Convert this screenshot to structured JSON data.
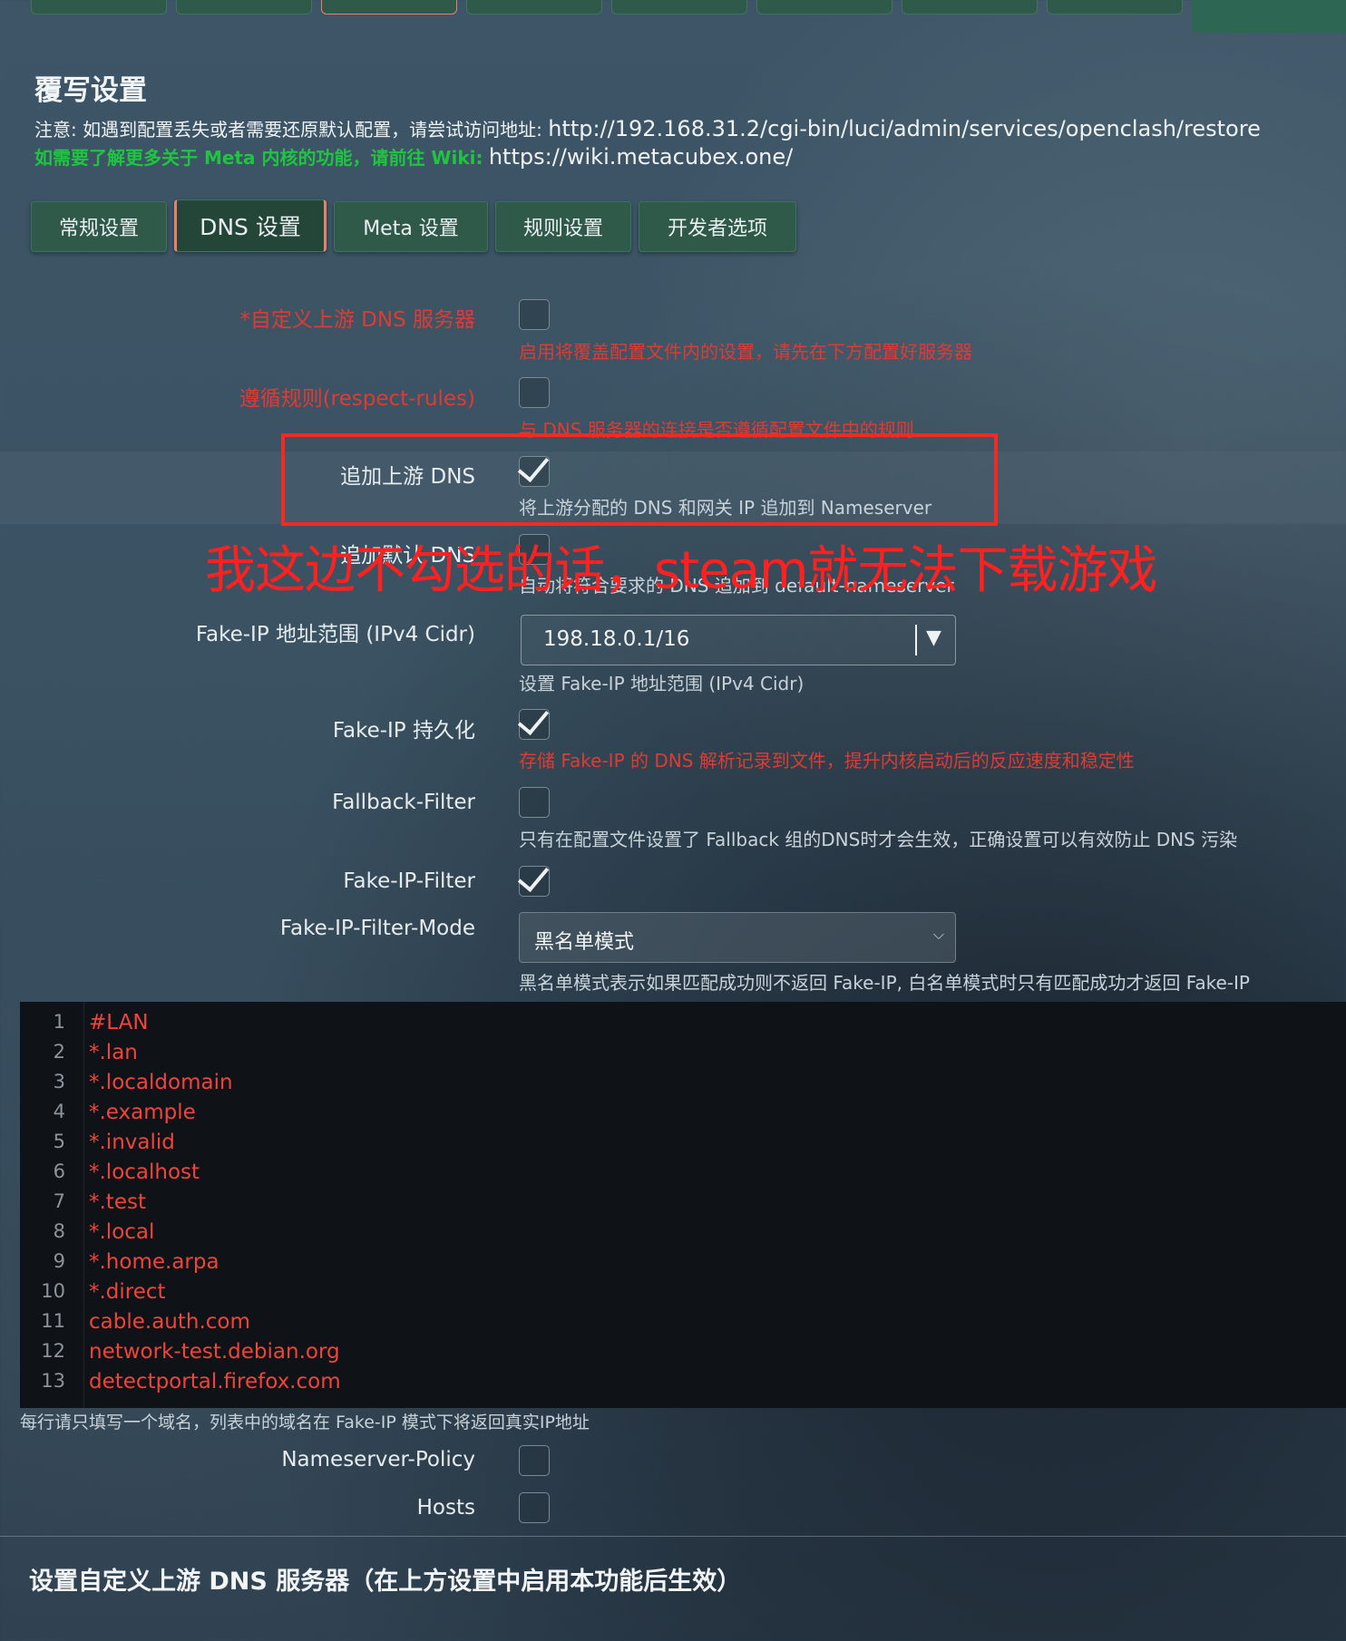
{
  "header": {
    "title": "覆写设置",
    "note_prefix": "注意: 如遇到配置丢失或者需要还原默认配置，请尝试访问地址:",
    "note_url": "http://192.168.31.2/cgi-bin/luci/admin/services/openclash/restore",
    "wiki_prefix": "如需要了解更多关于 Meta 内核的功能，请前往 Wiki:",
    "wiki_url": "https://wiki.metacubex.one/"
  },
  "tabs": [
    "常规设置",
    "DNS 设置",
    "Meta 设置",
    "规则设置",
    "开发者选项"
  ],
  "active_tab": "DNS 设置",
  "settings": {
    "custom_dns": {
      "label": "*自定义上游 DNS 服务器",
      "checked": false,
      "desc": "启用将覆盖配置文件内的设置，请先在下方配置好服务器"
    },
    "respect_rules": {
      "label": "遵循规则(respect-rules)",
      "checked": false,
      "desc": "与 DNS 服务器的连接是否遵循配置文件中的规则"
    },
    "append_upstream": {
      "label": "追加上游 DNS",
      "checked": true,
      "desc": "将上游分配的 DNS 和网关 IP 追加到 Nameserver"
    },
    "append_default": {
      "label": "追加默认 DNS",
      "checked": false,
      "desc": "自动将符合要求的 DNS 追加到 default-nameserver"
    },
    "fakeip_range": {
      "label": "Fake-IP 地址范围 (IPv4 Cidr)",
      "value": "198.18.0.1/16",
      "desc": "设置 Fake-IP 地址范围 (IPv4 Cidr)"
    },
    "fakeip_persist": {
      "label": "Fake-IP 持久化",
      "checked": true,
      "desc": "存储 Fake-IP 的 DNS 解析记录到文件，提升内核启动后的反应速度和稳定性"
    },
    "fallback_filter": {
      "label": "Fallback-Filter",
      "checked": false,
      "desc": "只有在配置文件设置了 Fallback 组的DNS时才会生效，正确设置可以有效防止 DNS 污染"
    },
    "fakeip_filter": {
      "label": "Fake-IP-Filter",
      "checked": true
    },
    "fakeip_filter_mode": {
      "label": "Fake-IP-Filter-Mode",
      "value": "黑名单模式",
      "desc": "黑名单模式表示如果匹配成功则不返回 Fake-IP, 白名单模式时只有匹配成功才返回 Fake-IP"
    },
    "nameserver_policy": {
      "label": "Nameserver-Policy",
      "checked": false
    },
    "hosts": {
      "label": "Hosts",
      "checked": false
    }
  },
  "annotation": "我这边不勾选的话，steam就无法下载游戏",
  "editor": {
    "lines": [
      "#LAN",
      "*.lan",
      "*.localdomain",
      "*.example",
      "*.invalid",
      "*.localhost",
      "*.test",
      "*.local",
      "*.home.arpa",
      "*.direct",
      "cable.auth.com",
      "network-test.debian.org",
      "detectportal.firefox.com"
    ],
    "hint": "每行请只填写一个域名，列表中的域名在 Fake-IP 模式下将返回真实IP地址"
  },
  "footer": {
    "title": "设置自定义上游 DNS 服务器（在上方设置中启用本功能后生效）"
  },
  "colors": {
    "accent_red": "#e03a33",
    "tab_bg": "#2f5a4a",
    "link_green": "#1fc441"
  }
}
